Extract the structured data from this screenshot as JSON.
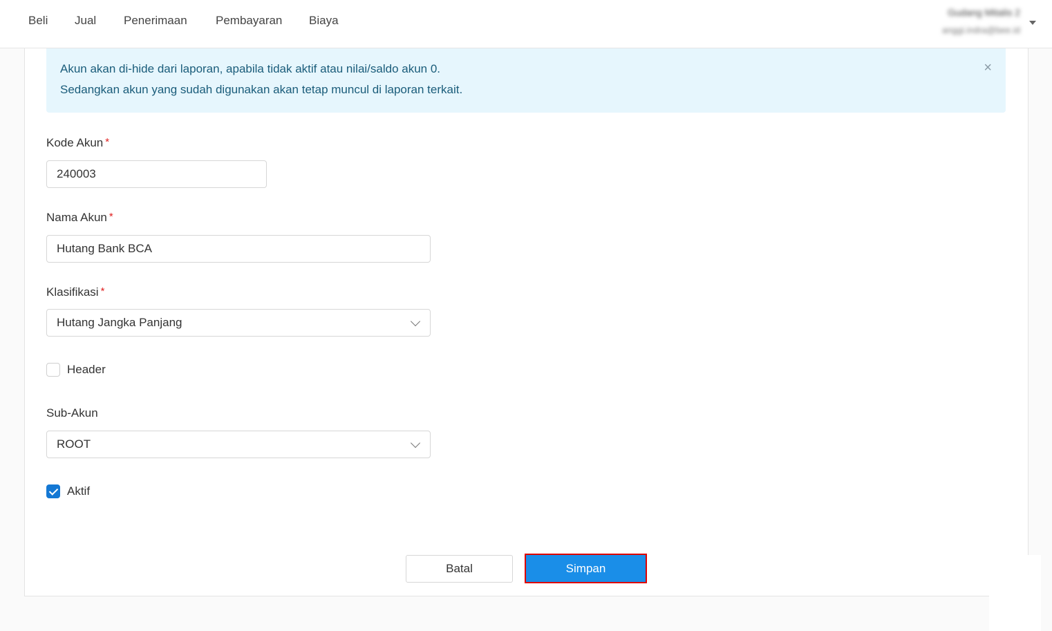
{
  "nav": {
    "items": [
      "Beli",
      "Jual",
      "Penerimaan",
      "Pembayaran",
      "Biaya"
    ],
    "user_name": "Gudang Mitalis 2",
    "user_email": "anggi.indra@bee.id"
  },
  "alert": {
    "line1": "Akun akan di-hide dari laporan, apabila tidak aktif atau nilai/saldo akun 0.",
    "line2": "Sedangkan akun yang sudah digunakan akan tetap muncul di laporan terkait.",
    "close_glyph": "×"
  },
  "form": {
    "kode_akun_label": "Kode Akun",
    "kode_akun_value": "240003",
    "nama_akun_label": "Nama Akun",
    "nama_akun_value": "Hutang Bank BCA",
    "klasifikasi_label": "Klasifikasi",
    "klasifikasi_value": "Hutang Jangka Panjang",
    "header_label": "Header",
    "header_checked": false,
    "sub_akun_label": "Sub-Akun",
    "sub_akun_value": "ROOT",
    "aktif_label": "Aktif",
    "aktif_checked": true,
    "required_mark": "*"
  },
  "buttons": {
    "cancel": "Batal",
    "save": "Simpan"
  },
  "colors": {
    "primary": "#1a8ee8",
    "checkbox_on": "#1478d4",
    "alert_bg": "#e6f6fd",
    "highlight_border": "#e00000"
  }
}
